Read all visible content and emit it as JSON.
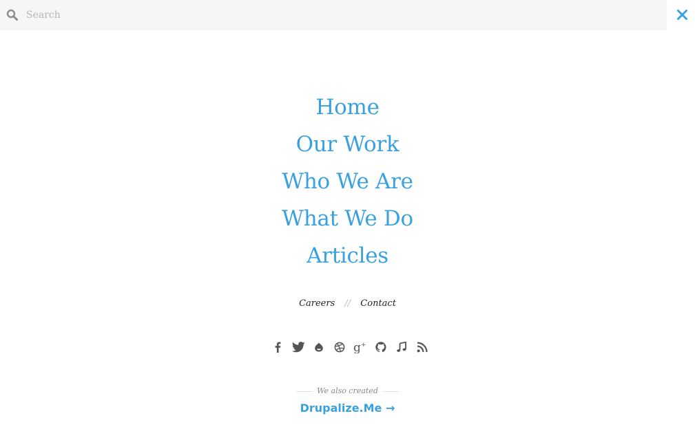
{
  "search": {
    "placeholder": "Search",
    "value": ""
  },
  "main_nav": {
    "items": [
      {
        "label": "Home"
      },
      {
        "label": "Our Work"
      },
      {
        "label": "Who We Are"
      },
      {
        "label": "What We Do"
      },
      {
        "label": "Articles"
      }
    ]
  },
  "secondary_nav": {
    "careers": "Careers",
    "separator": "//",
    "contact": "Contact"
  },
  "social": {
    "icons": [
      "facebook-icon",
      "twitter-icon",
      "drupal-icon",
      "dribbble-icon",
      "google-plus-icon",
      "github-icon",
      "music-icon",
      "rss-icon"
    ]
  },
  "also_created": {
    "label": "We also created",
    "link_label": "Drupalize.Me",
    "arrow": "→"
  },
  "colors": {
    "accent": "#3aa1e0",
    "icon": "#555555",
    "search_bg": "#f6f6f6"
  }
}
